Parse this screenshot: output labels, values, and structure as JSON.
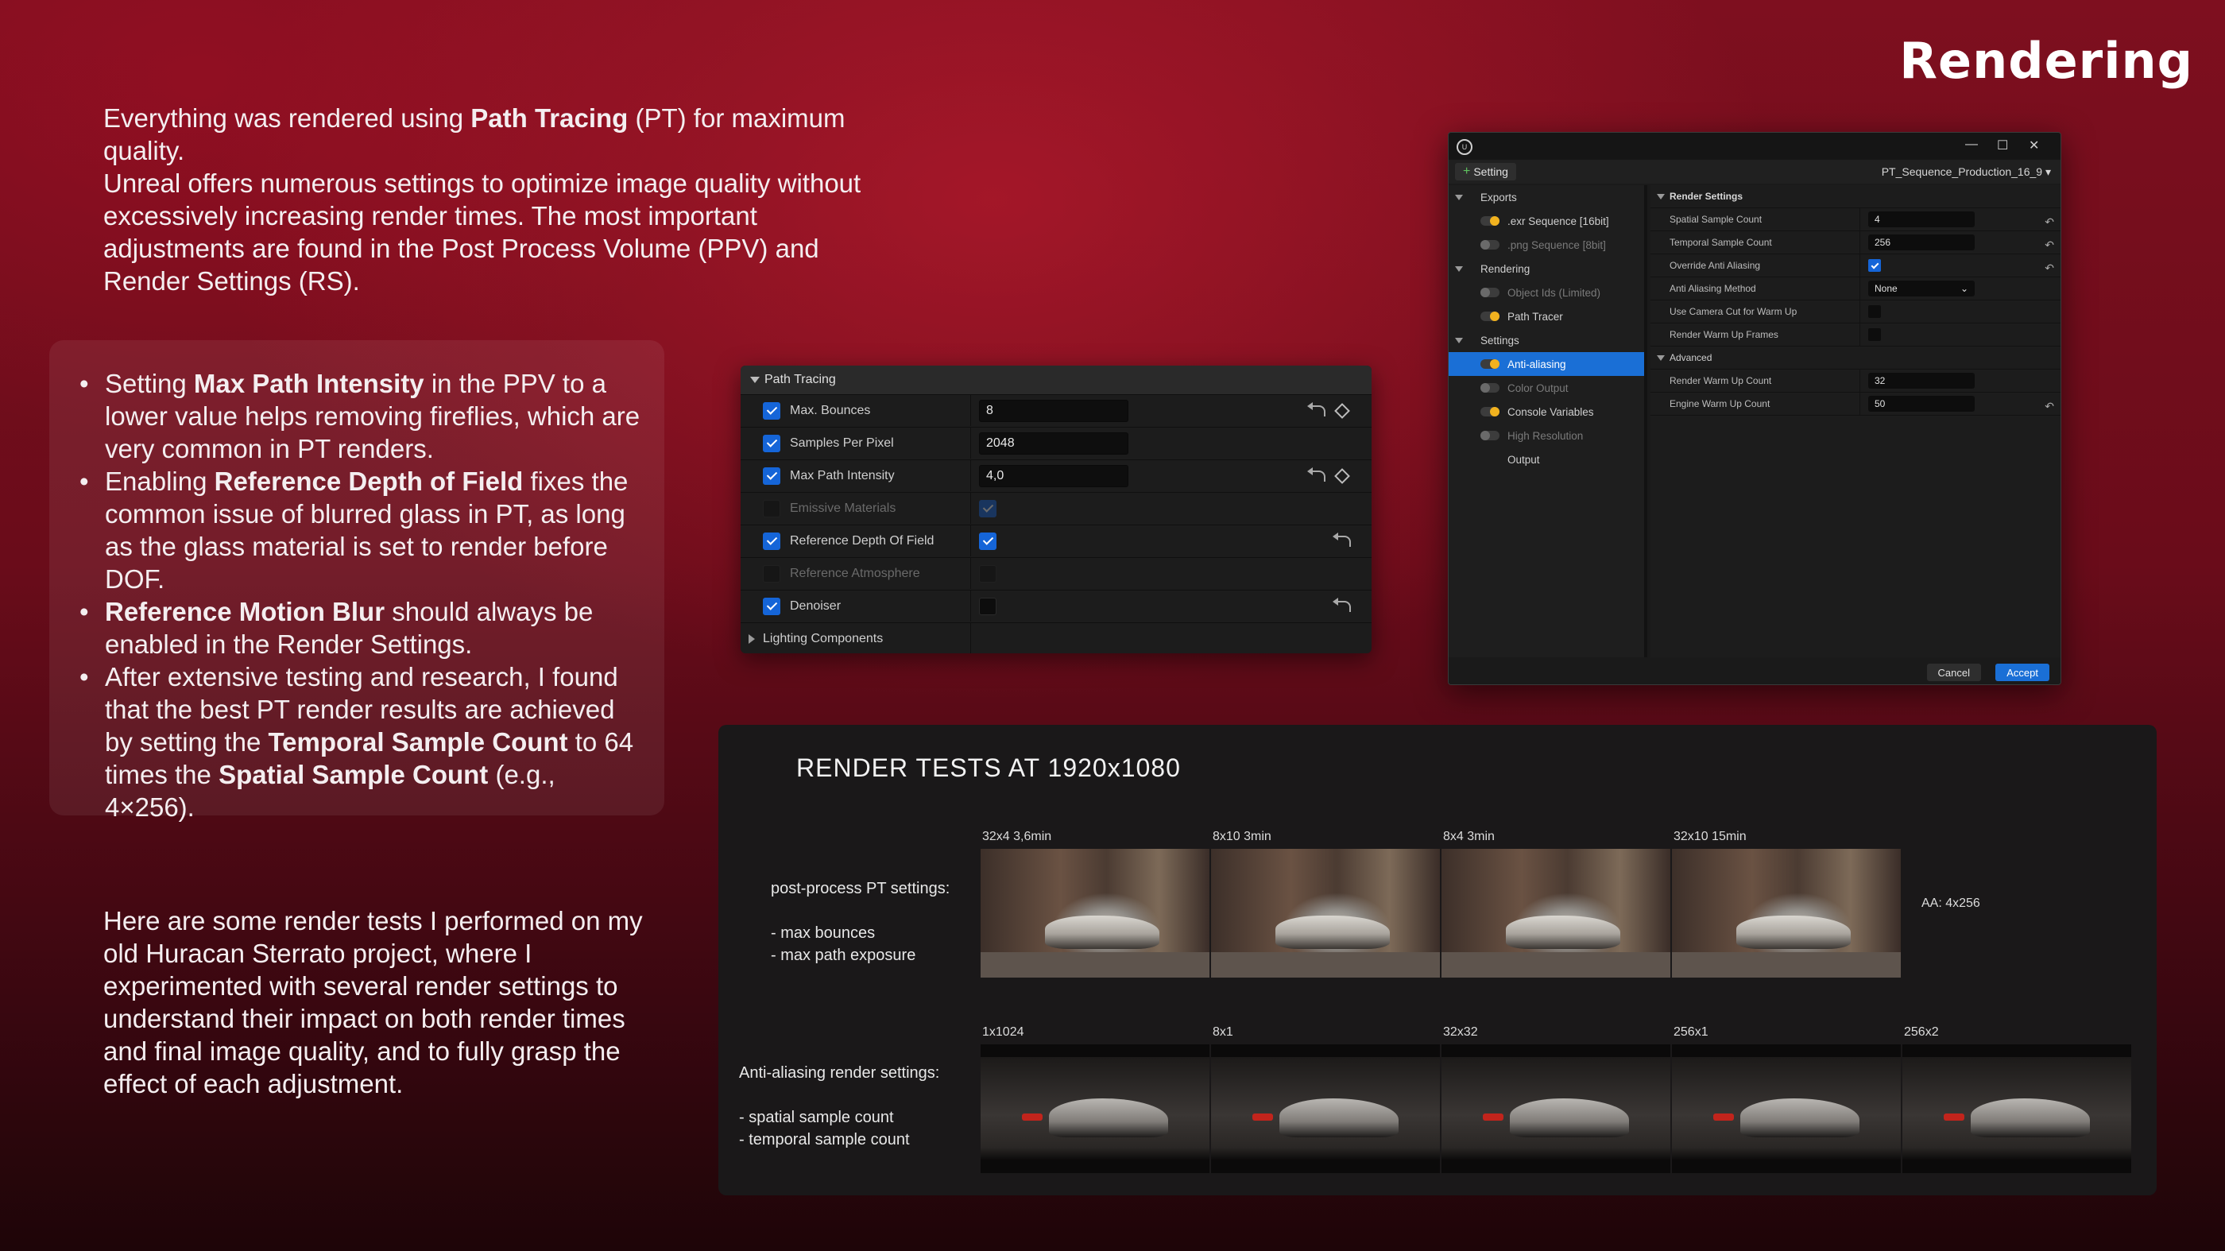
{
  "page": {
    "title": "Rendering",
    "intro": {
      "p1_a": "Everything was rendered using ",
      "p1_b": "Path Tracing",
      "p1_c": " (PT) for maximum quality.",
      "p2": "Unreal offers numerous settings to optimize image quality without excessively increasing render times. The most important adjustments are found in the Post Process Volume (PPV) and Render Settings (RS)."
    },
    "bullets": [
      {
        "pre": "Setting ",
        "bold": "Max Path Intensity",
        "post": " in the PPV to a lower value helps removing fireflies, which are very common in PT renders."
      },
      {
        "pre": "Enabling ",
        "bold": "Reference Depth of Field",
        "post": " fixes the common issue of blurred glass in PT, as long as the glass material is set to render before DOF."
      },
      {
        "pre": "",
        "bold": "Reference Motion Blur",
        "post": " should always be enabled in the Render Settings."
      },
      {
        "pre": "After extensive testing and research, I found that the best PT render results are achieved by setting the ",
        "bold": "Temporal Sample Count",
        "post": " to 64 times the ",
        "bold2": "Spatial Sample Count",
        "post2": " (e.g., 4×256)."
      }
    ],
    "outro": "Here are some render tests I performed on my old Huracan Sterrato project, where I experimented with several render settings to understand their impact on both render times and final image quality, and to fully grasp the effect of each adjustment."
  },
  "path_tracing_panel": {
    "header": "Path Tracing",
    "rows": [
      {
        "label": "Max. Bounces",
        "checked": true,
        "value": "8"
      },
      {
        "label": "Samples Per Pixel",
        "checked": true,
        "value": "2048"
      },
      {
        "label": "Max Path Intensity",
        "checked": true,
        "value": "4,0"
      },
      {
        "label": "Emissive Materials",
        "checked": false
      },
      {
        "label": "Reference Depth Of Field",
        "checked": true
      },
      {
        "label": "Reference Atmosphere",
        "checked": false
      },
      {
        "label": "Denoiser",
        "checked": true
      }
    ],
    "footer_section": "Lighting Components"
  },
  "mrq_window": {
    "window_controls": [
      "—",
      "☐",
      "✕"
    ],
    "add_setting": "Setting",
    "preset": "PT_Sequence_Production_16_9 ▾",
    "tree": {
      "exports": "Exports",
      "exr": ".exr Sequence [16bit]",
      "png": ".png Sequence [8bit]",
      "rendering": "Rendering",
      "object_ids": "Object Ids (Limited)",
      "path_tracer": "Path Tracer",
      "settings": "Settings",
      "anti_aliasing": "Anti-aliasing",
      "color_output": "Color Output",
      "console_variables": "Console Variables",
      "high_resolution": "High Resolution",
      "output": "Output"
    },
    "render_settings": {
      "header": "Render Settings",
      "spatial_label": "Spatial Sample Count",
      "spatial_value": "4",
      "temporal_label": "Temporal Sample Count",
      "temporal_value": "256",
      "override_label": "Override Anti Aliasing",
      "method_label": "Anti Aliasing Method",
      "method_value": "None",
      "camera_cut_label": "Use Camera Cut for Warm Up",
      "warm_frames_label": "Render Warm Up Frames",
      "advanced_header": "Advanced",
      "warm_count_label": "Render Warm Up Count",
      "warm_count_value": "32",
      "engine_warm_label": "Engine Warm Up Count",
      "engine_warm_value": "50"
    },
    "cancel": "Cancel",
    "accept": "Accept"
  },
  "render_tests": {
    "title": "RENDER TESTS AT 1920x1080",
    "pp_label_1": "post-process PT settings:",
    "pp_label_2": "- max bounces",
    "pp_label_3": "- max path exposure",
    "pp_thumbs": [
      "32x4 3,6min",
      "8x10 3min",
      "8x4 3min",
      "32x10 15min"
    ],
    "pp_note": "AA: 4x256",
    "aa_label_1": "Anti-aliasing render settings:",
    "aa_label_2": "- spatial sample count",
    "aa_label_3": "- temporal sample count",
    "aa_thumbs": [
      "1x1024",
      "8x1",
      "32x32",
      "256x1",
      "256x2"
    ]
  }
}
